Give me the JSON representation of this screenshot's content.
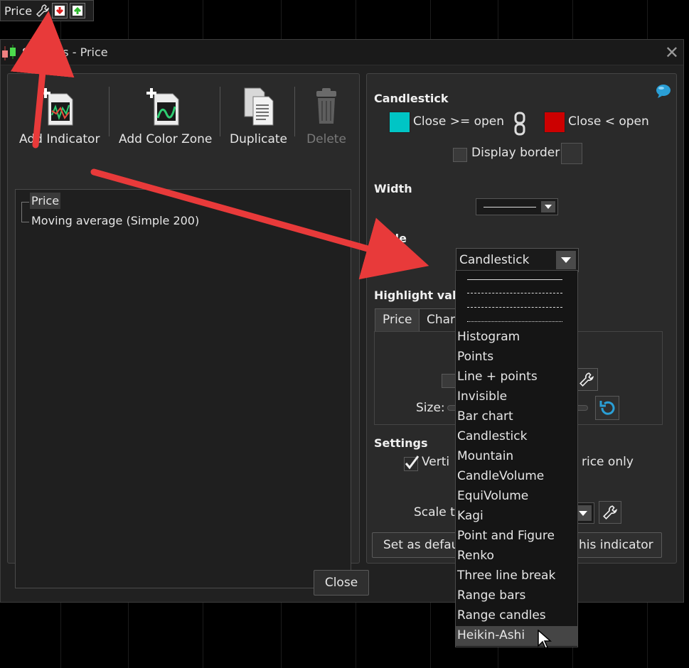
{
  "price_tag": {
    "label": "Price"
  },
  "dialog": {
    "title": "Settings - Price",
    "close_x": "✕",
    "close_button": "Close"
  },
  "toolbar": {
    "add_indicator": "Add Indicator",
    "add_color_zone": "Add Color Zone",
    "duplicate": "Duplicate",
    "delete": "Delete"
  },
  "tree": {
    "items": [
      "Price",
      "Moving average (Simple 200)"
    ]
  },
  "candlestick": {
    "title": "Candlestick",
    "up_label": "Close >= open",
    "down_label": "Close < open",
    "up_color": "#00c5c5",
    "down_color": "#cc0000",
    "display_border": "Display border"
  },
  "width": {
    "title": "Width"
  },
  "style": {
    "title": "Style",
    "selected": "Candlestick"
  },
  "highlight": {
    "title": "Highlight valu",
    "tab_price": "Price",
    "tab_change": "Chan",
    "size_label": "Size:"
  },
  "settings": {
    "title": "Settings",
    "vertical": "Verti",
    "price_only": "rice only",
    "scale_type": "Scale ty",
    "set_default": "Set as defau",
    "this_indicator": "his indicator"
  },
  "dropdown_options": [
    "Histogram",
    "Points",
    "Line + points",
    "Invisible",
    "Bar chart",
    "Candlestick",
    "Mountain",
    "CandleVolume",
    "EquiVolume",
    "Kagi",
    "Point and Figure",
    "Renko",
    "Three line break",
    "Range bars",
    "Range candles",
    "Heikin-Ashi"
  ],
  "colors": {
    "arrow": "#e83a3a",
    "accent_blue": "#2a9fd6"
  }
}
